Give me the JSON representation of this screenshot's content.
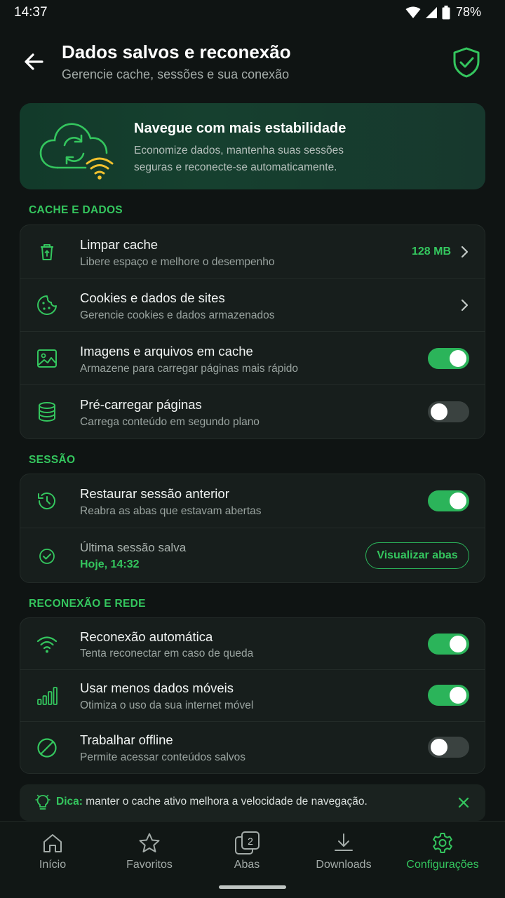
{
  "status": {
    "time": "14:37",
    "battery": "78%"
  },
  "header": {
    "title": "Dados salvos e reconexão",
    "subtitle": "Gerencie cache, sessões e sua conexão"
  },
  "hero": {
    "title": "Navegue com mais estabilidade",
    "text": "Economize dados, mantenha suas sessões seguras e reconecte-se automaticamente."
  },
  "sections": {
    "cache": {
      "label": "CACHE E DADOS",
      "rows": [
        {
          "title": "Limpar cache",
          "subtitle": "Libere espaço e melhore o desempenho",
          "value": "128 MB"
        },
        {
          "title": "Cookies e dados de sites",
          "subtitle": "Gerencie cookies e dados armazenados"
        },
        {
          "title": "Imagens e arquivos em cache",
          "subtitle": "Armazene para carregar páginas mais rápido",
          "enabled": true
        },
        {
          "title": "Pré-carregar páginas",
          "subtitle": "Carrega conteúdo em segundo plano",
          "enabled": false
        }
      ]
    },
    "session": {
      "label": "SESSÃO",
      "restore": {
        "title": "Restaurar sessão anterior",
        "subtitle": "Reabra as abas que estavam abertas",
        "enabled": true
      },
      "last_saved": {
        "title": "Última sessão salva",
        "value": "Hoje, 14:32",
        "button": "Visualizar abas"
      }
    },
    "network": {
      "label": "RECONEXÃO E REDE",
      "rows": [
        {
          "title": "Reconexão automática",
          "subtitle": "Tenta reconectar em caso de queda",
          "enabled": true
        },
        {
          "title": "Usar menos dados móveis",
          "subtitle": "Otimiza o uso da sua internet móvel",
          "enabled": true
        },
        {
          "title": "Trabalhar offline",
          "subtitle": "Permite acessar conteúdos salvos",
          "enabled": false
        }
      ]
    }
  },
  "tip": {
    "label": "Dica:",
    "text": " manter o cache ativo melhora a velocidade de navegação."
  },
  "nav": {
    "items": [
      {
        "label": "Início",
        "icon": "home-icon"
      },
      {
        "label": "Favoritos",
        "icon": "star-icon"
      },
      {
        "label": "Abas",
        "icon": "tabs-icon",
        "badge": "2"
      },
      {
        "label": "Downloads",
        "icon": "download-icon"
      },
      {
        "label": "Configurações",
        "icon": "gear-icon",
        "active": true
      }
    ]
  },
  "colors": {
    "accent": "#34c65e",
    "background": "#0f1413",
    "card": "#171e1c",
    "warning": "#f2c12e"
  }
}
